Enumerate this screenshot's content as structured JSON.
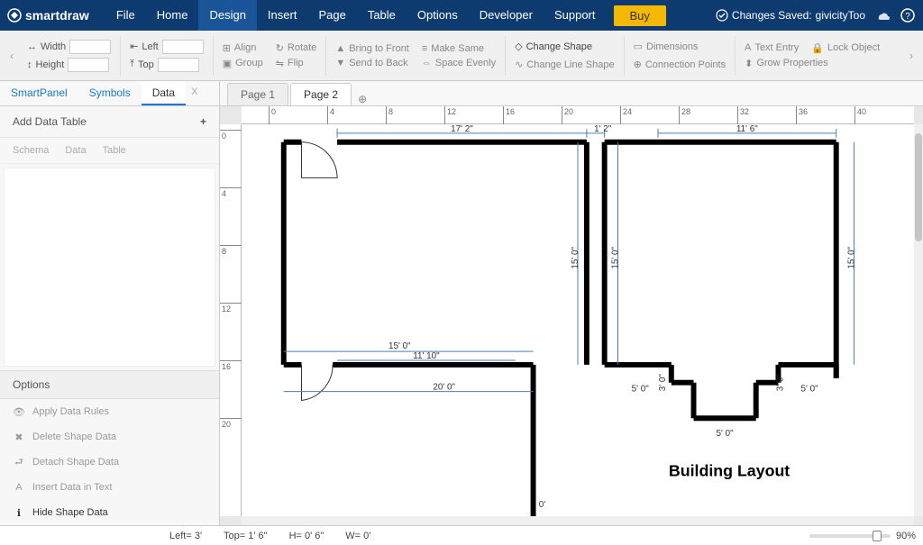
{
  "brand": "smartdraw",
  "menu": {
    "items": [
      "File",
      "Home",
      "Design",
      "Insert",
      "Page",
      "Table",
      "Options",
      "Developer",
      "Support"
    ],
    "active": 2,
    "buy": "Buy"
  },
  "status": {
    "saved_prefix": "Changes Saved:",
    "user": "givicityToo"
  },
  "ribbon": {
    "width_label": "Width",
    "left_label": "Left",
    "height_label": "Height",
    "top_label": "Top",
    "align": "Align",
    "rotate": "Rotate",
    "group": "Group",
    "flip": "Flip",
    "bring_front": "Bring to Front",
    "make_same": "Make Same",
    "send_back": "Send to Back",
    "space_evenly": "Space Evenly",
    "change_shape": "Change Shape",
    "change_line": "Change Line Shape",
    "dimensions": "Dimensions",
    "conn_points": "Connection Points",
    "text_entry": "Text Entry",
    "lock_obj": "Lock Object",
    "grow_props": "Grow Properties"
  },
  "side_tabs": [
    "SmartPanel",
    "Symbols",
    "Data"
  ],
  "side_active": 2,
  "doc_tabs": [
    "Page 1",
    "Page 2"
  ],
  "doc_active": 1,
  "data_panel": {
    "add_table": "Add Data Table",
    "subtabs": [
      "Schema",
      "Data",
      "Table"
    ],
    "options_head": "Options",
    "options": [
      {
        "icon": "eye",
        "label": "Apply Data Rules",
        "dark": false
      },
      {
        "icon": "x",
        "label": "Delete Shape Data",
        "dark": false
      },
      {
        "icon": "detach",
        "label": "Detach Shape Data",
        "dark": false
      },
      {
        "icon": "A",
        "label": "Insert Data in Text",
        "dark": false
      },
      {
        "icon": "info",
        "label": "Hide Shape Data",
        "dark": true
      }
    ]
  },
  "hruler_ticks": [
    {
      "p": 30,
      "l": "0"
    },
    {
      "p": 95,
      "l": "4"
    },
    {
      "p": 160,
      "l": "8"
    },
    {
      "p": 225,
      "l": "12"
    },
    {
      "p": 290,
      "l": "16"
    },
    {
      "p": 355,
      "l": "20"
    },
    {
      "p": 420,
      "l": "24"
    },
    {
      "p": 485,
      "l": "28"
    },
    {
      "p": 550,
      "l": "32"
    },
    {
      "p": 615,
      "l": "36"
    },
    {
      "p": 680,
      "l": "40"
    }
  ],
  "vruler_ticks": [
    {
      "p": 6,
      "l": "0"
    },
    {
      "p": 70,
      "l": "4"
    },
    {
      "p": 134,
      "l": "8"
    },
    {
      "p": 198,
      "l": "12"
    },
    {
      "p": 262,
      "l": "16"
    },
    {
      "p": 326,
      "l": "20"
    }
  ],
  "plan": {
    "dims": {
      "d1": "17' 2\"",
      "d2": "1' 2\"",
      "d3": "11' 6\"",
      "d4": "15' 0\"",
      "d5": "15' 0\"",
      "d6": "15' 0\"",
      "d7": "15' 0\"",
      "d8": "11' 10\"",
      "d9": "20' 0\"",
      "d10": "5' 0\"",
      "d11": "3' 0\"",
      "d12": "3' 0\"",
      "d13": "5' 0\"",
      "d14": "5' 0\"",
      "d15": "0'"
    },
    "title": "Building Layout"
  },
  "statusbar": {
    "left": "Left= 3'",
    "top": "Top= 1' 6\"",
    "h": "H= 0' 6\"",
    "w": "W= 0'",
    "zoom": "90%"
  }
}
